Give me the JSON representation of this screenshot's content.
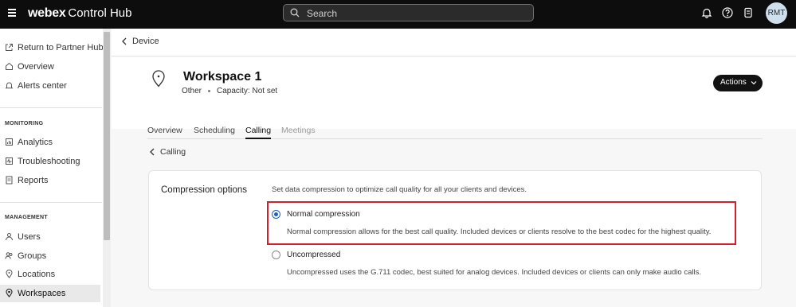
{
  "app": {
    "brand_bold": "webex",
    "brand_rest": "Control Hub",
    "search_placeholder": "Search",
    "avatar_initials": "RMT"
  },
  "sidebar": {
    "top_items": [
      {
        "label": "Return to Partner Hub",
        "icon": "external-link-icon"
      },
      {
        "label": "Overview",
        "icon": "home-icon"
      },
      {
        "label": "Alerts center",
        "icon": "bell-icon"
      }
    ],
    "monitoring_heading": "MONITORING",
    "monitoring_items": [
      {
        "label": "Analytics",
        "icon": "chart-icon"
      },
      {
        "label": "Troubleshooting",
        "icon": "wave-icon"
      },
      {
        "label": "Reports",
        "icon": "document-icon"
      }
    ],
    "management_heading": "MANAGEMENT",
    "management_items": [
      {
        "label": "Users",
        "icon": "user-icon"
      },
      {
        "label": "Groups",
        "icon": "group-icon"
      },
      {
        "label": "Locations",
        "icon": "location-icon"
      },
      {
        "label": "Workspaces",
        "icon": "workspace-icon",
        "active": true
      }
    ]
  },
  "breadcrumb": {
    "back_label": "Device"
  },
  "workspace": {
    "title": "Workspace 1",
    "type": "Other",
    "capacity": "Capacity: Not set",
    "actions_label": "Actions"
  },
  "tabs": [
    {
      "label": "Overview"
    },
    {
      "label": "Scheduling"
    },
    {
      "label": "Calling",
      "active": true
    },
    {
      "label": "Meetings",
      "disabled": true
    }
  ],
  "sub_back_label": "Calling",
  "compression": {
    "title": "Compression options",
    "description": "Set data compression to optimize call quality for all your clients and devices.",
    "options": [
      {
        "label": "Normal compression",
        "description": "Normal compression allows for the best call quality. Included devices or clients resolve to the best codec for the highest quality.",
        "selected": true
      },
      {
        "label": "Uncompressed",
        "description": "Uncompressed uses the G.711 codec, best suited for analog devices. Included devices or clients can only make audio calls.",
        "selected": false
      }
    ]
  },
  "colors": {
    "highlight_border": "#d21f2e",
    "radio_selected": "#1f5fbf",
    "topbar_bg": "#0d0d0d"
  }
}
